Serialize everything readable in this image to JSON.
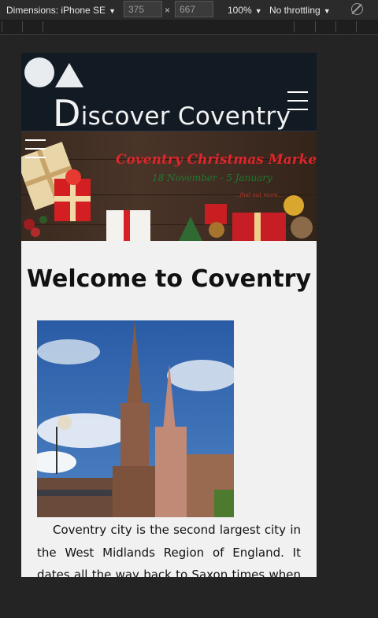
{
  "devtools": {
    "device_label": "Dimensions: iPhone SE",
    "width_value": "375",
    "height_value": "667",
    "times": "×",
    "zoom": "100%",
    "throttling": "No throttling"
  },
  "header": {
    "logo_d": "D",
    "logo_rest": "iscover Coventry"
  },
  "hero": {
    "title": "Coventry Christmas Market",
    "subtitle": "18 November - 5 January",
    "link": "...find out more..."
  },
  "main": {
    "title": "Welcome to Coventry",
    "intro": "Coventry city is the second largest city in the West Midlands Region of England. It dates all the way back to Saxon times when Earl"
  },
  "colors": {
    "header_bg": "#121b24",
    "hero_title": "#e0252b",
    "hero_subtitle": "#1f7a2e",
    "content_bg": "#f1f1f1"
  }
}
